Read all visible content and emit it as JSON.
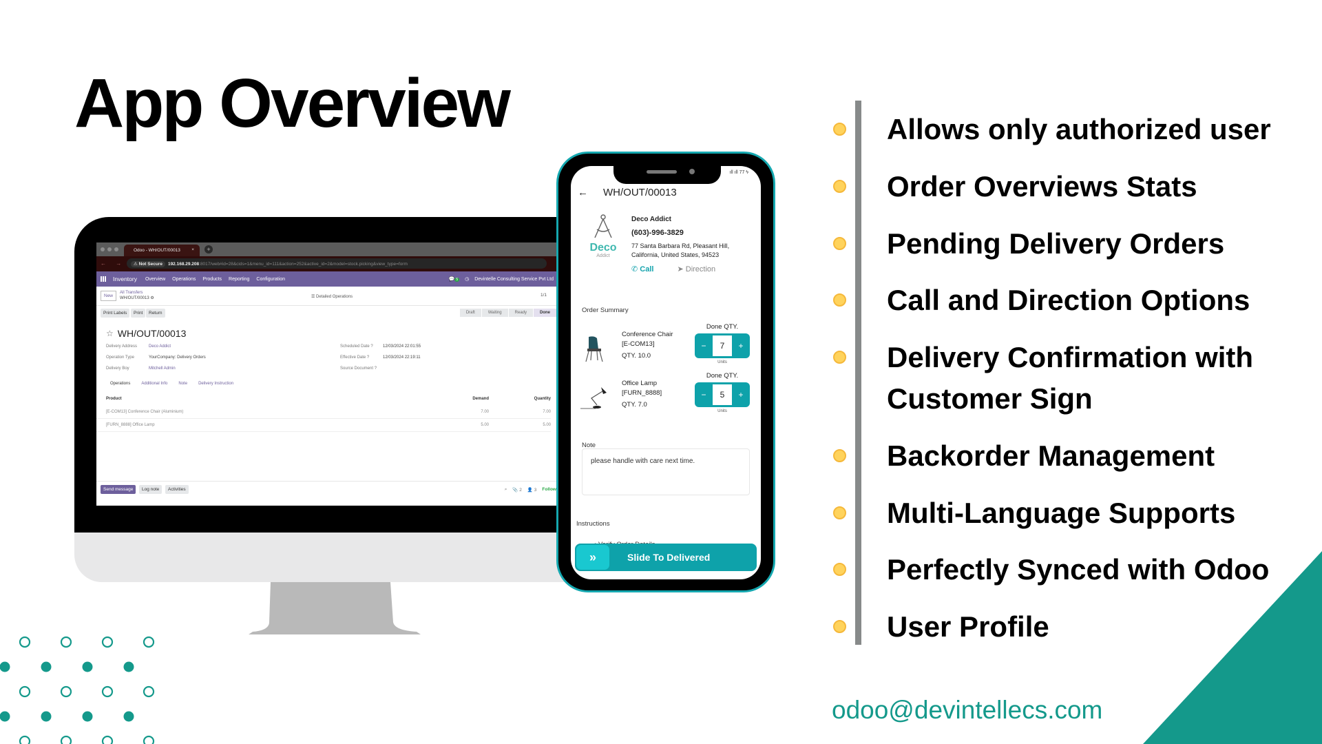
{
  "title": "App Overview",
  "colors": {
    "teal": "#14998b",
    "bullet": "#ffd35c",
    "odoo_purple": "#6d5f9c",
    "phone_accent": "#0ea2aa"
  },
  "features": [
    {
      "label": "Allows only authorized user"
    },
    {
      "label": "Order Overviews Stats"
    },
    {
      "label": "Pending Delivery Orders"
    },
    {
      "label": "Call and Direction Options"
    },
    {
      "label": "Delivery Confirmation with"
    },
    {
      "label": "Customer Sign"
    },
    {
      "label": "Backorder Management"
    },
    {
      "label": "Multi-Language Supports"
    },
    {
      "label": "Perfectly Synced with Odoo"
    },
    {
      "label": "User Profile"
    }
  ],
  "contact_email": "odoo@devintellecs.com",
  "desktop": {
    "browser": {
      "tab_title": "Odoo - WH/OUT/00013",
      "tab_close": "×",
      "new_tab": "+",
      "nav": "← → C",
      "not_secure": "⚠ Not Secure",
      "url_host": "192.168.29.208",
      "url_rest": ":8017/web#id=28&cids=1&menu_id=111&action=252&active_id=2&model=stock.picking&view_type=form"
    },
    "odoo_nav": {
      "app_name": "Inventory",
      "menu": [
        "Overview",
        "Operations",
        "Products",
        "Reporting",
        "Configuration"
      ],
      "chat_count": "5",
      "company": "Devintelle Consulting Service Pvt Ltd"
    },
    "control_panel": {
      "new_button": "New",
      "breadcrumb_parent": "All Transfers",
      "breadcrumb_current": "WH/OUT/00013 ⚙",
      "detailed_operations": "☰ Detailed Operations",
      "pager": "1/1"
    },
    "actions": [
      "Print Labels",
      "Print",
      "Return"
    ],
    "status_steps": [
      "Draft",
      "Waiting",
      "Ready",
      "Done"
    ],
    "record": {
      "title": "WH/OUT/00013",
      "fields_left": [
        {
          "label": "Delivery Address",
          "value": "Deco Addict"
        },
        {
          "label": "Operation Type",
          "value": "YourCompany: Delivery Orders"
        },
        {
          "label": "Delivery Boy",
          "value": "Mitchell Admin"
        }
      ],
      "fields_right": [
        {
          "label": "Scheduled Date ?",
          "value": "12/03/2024 22:01:55"
        },
        {
          "label": "Effective Date ?",
          "value": "12/03/2024 22:19:11"
        },
        {
          "label": "Source Document ?",
          "value": ""
        }
      ],
      "tabs": [
        "Operations",
        "Additional Info",
        "Note",
        "Delivery Instruction"
      ],
      "table_headers": {
        "product": "Product",
        "demand": "Demand",
        "quantity": "Quantity"
      },
      "rows": [
        {
          "product": "[E-COM13] Conference Chair (Aluminium)",
          "demand": "7.00",
          "quantity": "7.00"
        },
        {
          "product": "[FURN_8888] Office Lamp",
          "demand": "5.00",
          "quantity": "5.00"
        }
      ]
    },
    "chatter": {
      "send_message": "Send message",
      "log_note": "Log note",
      "activities": "Activities",
      "attachments": "📎 2",
      "followers": "👤 3",
      "follow": "Follow"
    }
  },
  "phone": {
    "status_icons": "ıll ıll 77 ϟ",
    "back": "←",
    "title": "WH/OUT/00013",
    "customer": {
      "logo_text": "Deco",
      "logo_sub": "Addict",
      "name": "Deco Addict",
      "phone": "(603)-996-3829",
      "address_line1": "77 Santa Barbara Rd, Pleasant Hill,",
      "address_line2": "California, United States, 94523",
      "call": "Call",
      "direction": "Direction"
    },
    "order_summary_label": "Order Summary",
    "lines": [
      {
        "name": "Conference Chair",
        "code": "[E-COM13]",
        "qty": "QTY. 10.0",
        "done_label": "Done QTY.",
        "done_value": "7",
        "units": "Units",
        "minus": "−",
        "plus": "+"
      },
      {
        "name": "Office Lamp",
        "code": "[FURN_8888]",
        "qty": "QTY. 7.0",
        "done_label": "Done QTY.",
        "done_value": "5",
        "units": "Units",
        "minus": "−",
        "plus": "+"
      }
    ],
    "note_label": "Note",
    "note_text": "please handle with care next time.",
    "instructions_label": "Instructions",
    "instruction_item": "• Verify Order Details",
    "slide_label": "Slide To Delivered",
    "slide_icon": "»"
  }
}
